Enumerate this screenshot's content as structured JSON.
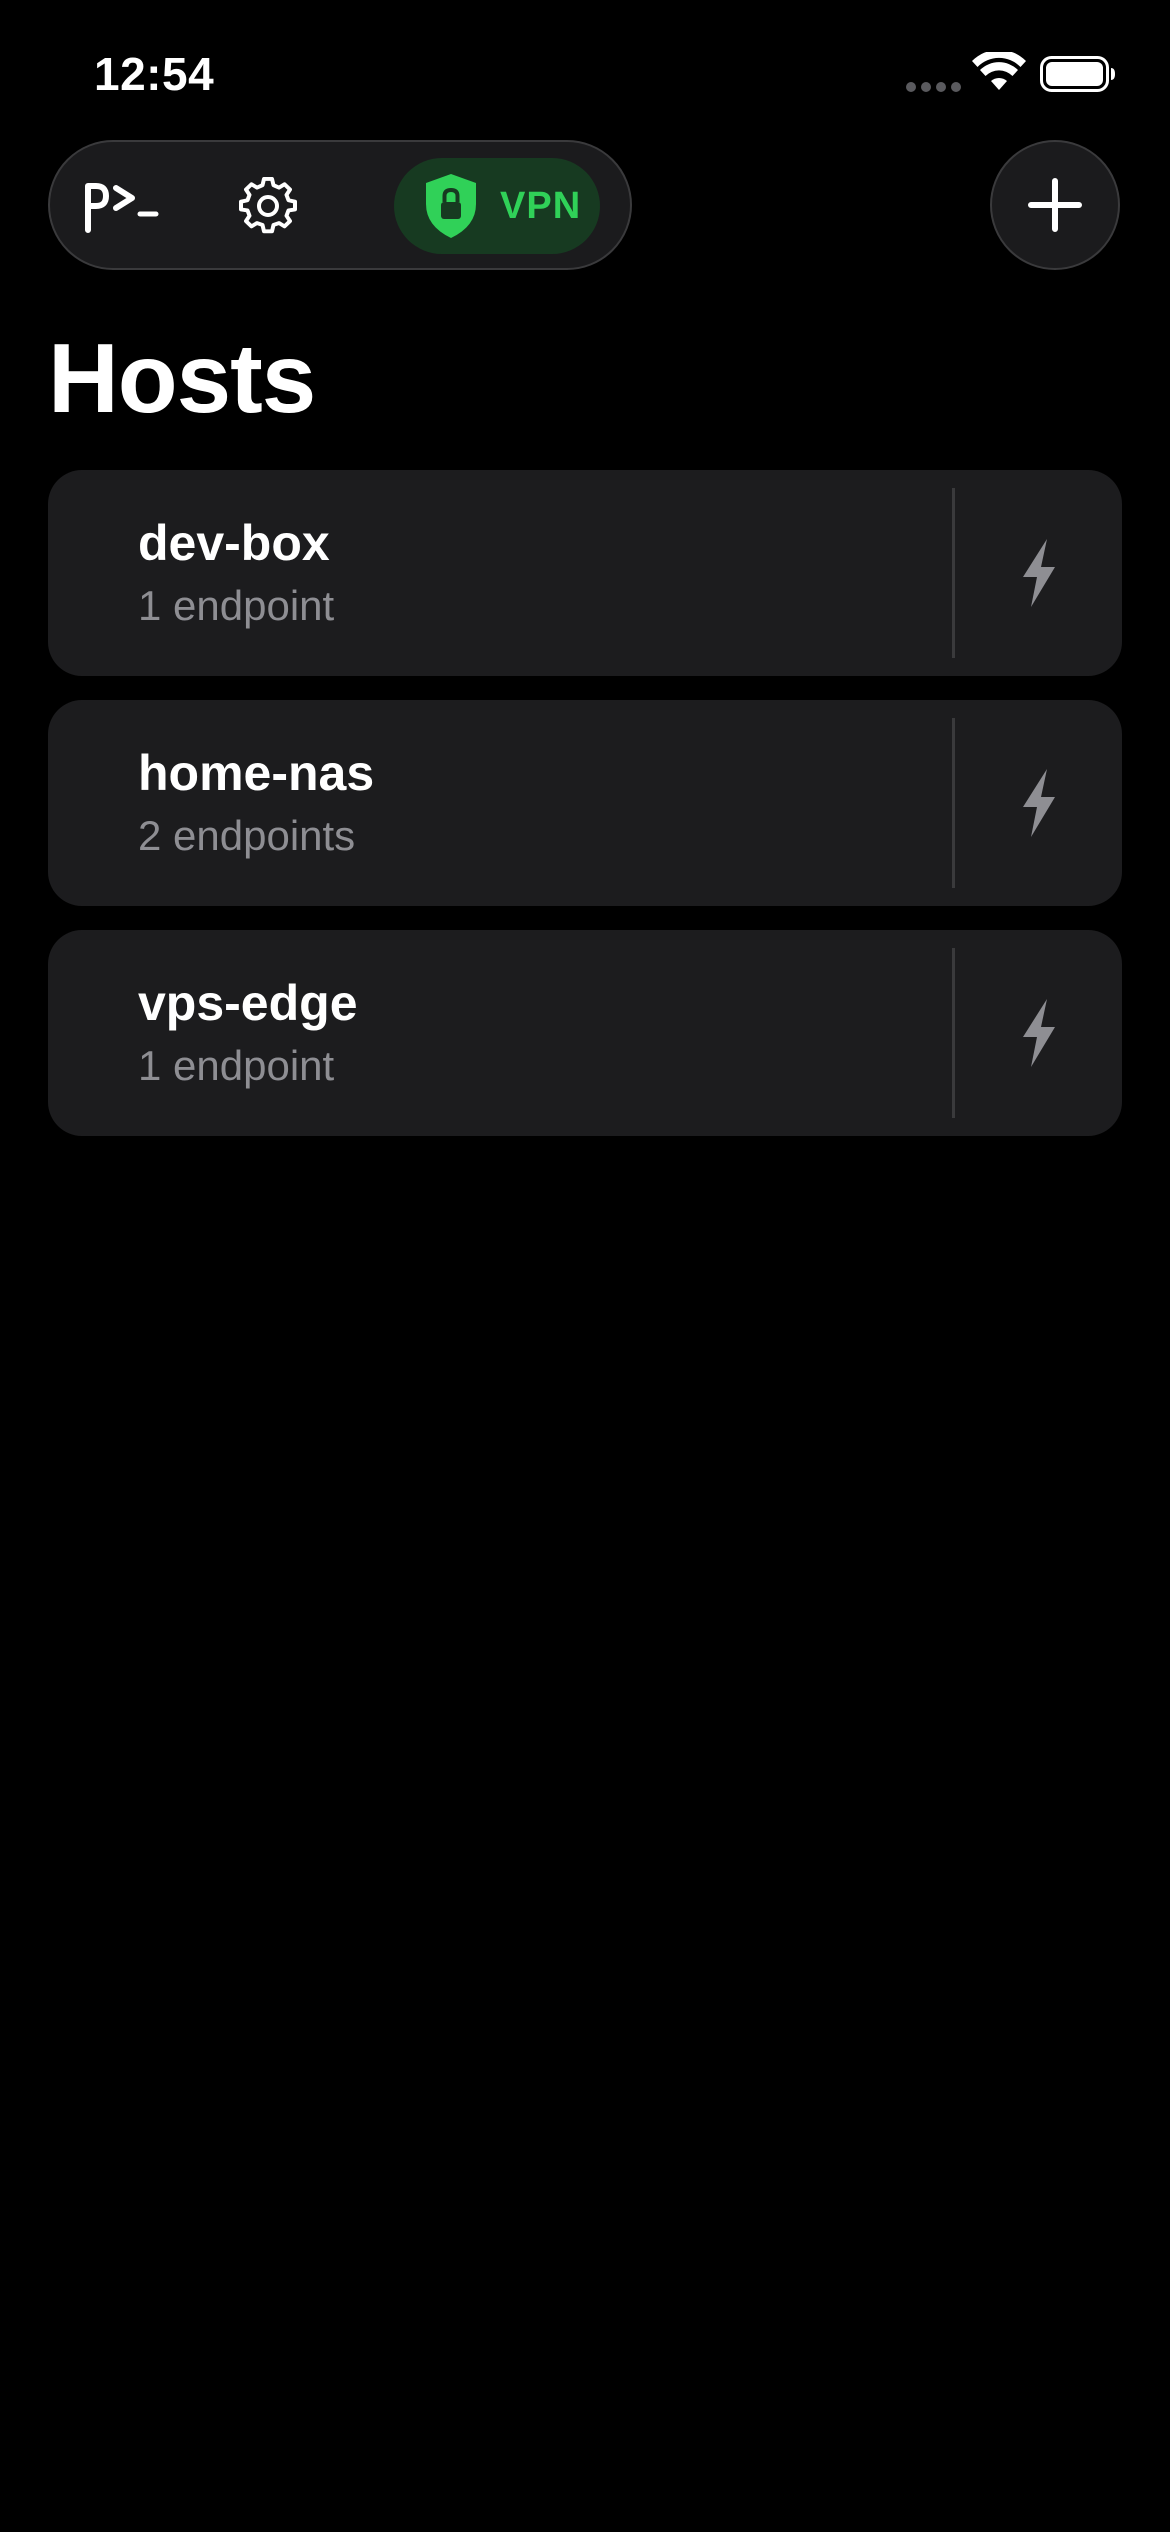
{
  "status_bar": {
    "time": "12:54"
  },
  "toolbar": {
    "logo_icon": "terminal-prompt-icon",
    "settings_icon": "gear-icon",
    "vpn_label": "VPN",
    "vpn_icon": "shield-lock-icon",
    "add_icon": "plus-icon"
  },
  "page": {
    "title": "Hosts"
  },
  "hosts": [
    {
      "name": "dev-box",
      "endpoints": "1 endpoint"
    },
    {
      "name": "home-nas",
      "endpoints": "2 endpoints"
    },
    {
      "name": "vps-edge",
      "endpoints": "1 endpoint"
    }
  ],
  "colors": {
    "background": "#000000",
    "card": "#1c1c1e",
    "accent_green": "#30d158",
    "secondary_text": "#8e8e93"
  }
}
